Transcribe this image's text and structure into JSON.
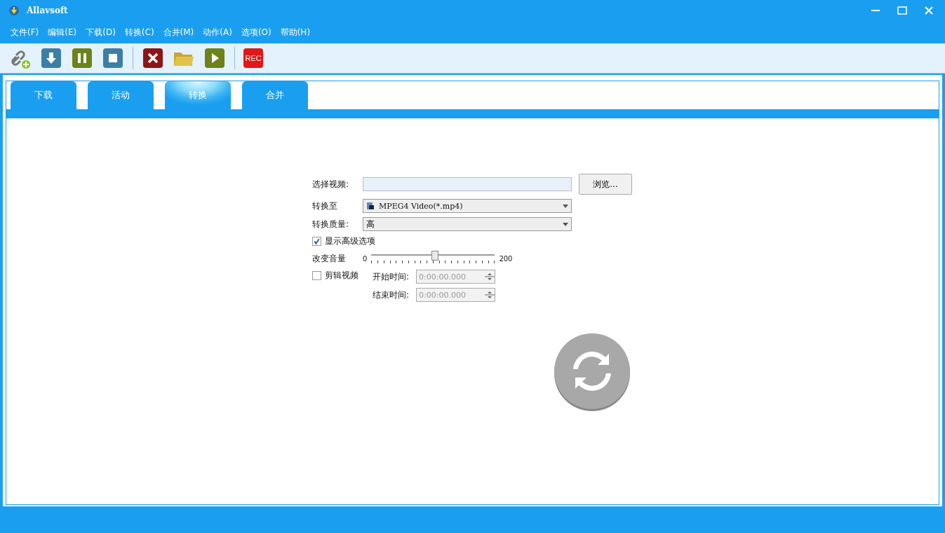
{
  "window": {
    "title": "Allavsoft"
  },
  "menu": [
    "文件(F)",
    "编辑(E)",
    "下载(D)",
    "转换(C)",
    "合并(M)",
    "动作(A)",
    "选项(O)",
    "帮助(H)"
  ],
  "toolbar": {
    "rec_label": "REC"
  },
  "tabs": [
    {
      "label": "下载",
      "selected": false
    },
    {
      "label": "活动",
      "selected": false
    },
    {
      "label": "转换",
      "selected": true
    },
    {
      "label": "合并",
      "selected": false
    }
  ],
  "form": {
    "select_video": {
      "label": "选择视频:",
      "browse": "浏览..."
    },
    "convert_to": {
      "label": "转换至",
      "value": "MPEG4 Video(*.mp4)"
    },
    "quality": {
      "label": "转换质量:",
      "value": "高"
    },
    "advanced": {
      "label": "显示高级选项",
      "checked": true
    },
    "volume": {
      "label": "改变音量",
      "min": "0",
      "max": "200",
      "level": 0.51
    },
    "trim": {
      "label": "剪辑视频",
      "checked": false
    },
    "start": {
      "label": "开始时间:",
      "value": "0:00:00.000",
      "disabled": true
    },
    "end": {
      "label": "结束时间:",
      "value": "0:00:00.000",
      "disabled": true
    }
  }
}
